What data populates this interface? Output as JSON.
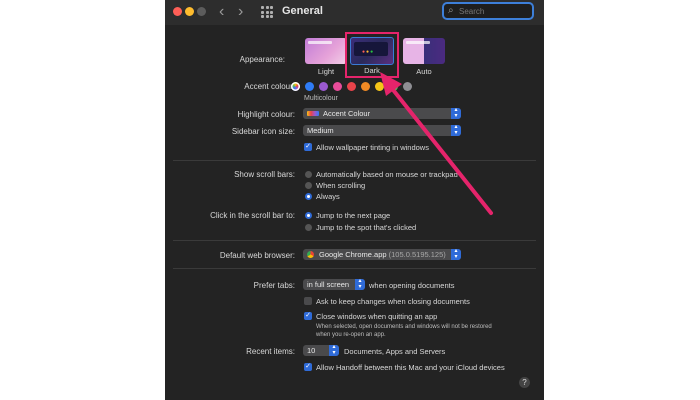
{
  "window": {
    "title": "General",
    "search_placeholder": "Search",
    "back_icon": "‹",
    "forward_icon": "›"
  },
  "appearance": {
    "label": "Appearance:",
    "options": [
      {
        "label": "Light"
      },
      {
        "label": "Dark"
      },
      {
        "label": "Auto"
      }
    ],
    "selected": "Dark"
  },
  "accent": {
    "label": "Accent colour:",
    "colors": [
      "multicolor",
      "#2f7cf6",
      "#9b59d0",
      "#e84c9a",
      "#e8434a",
      "#f08a24",
      "#f5c518",
      "#5cb85c",
      "#8e8e93"
    ],
    "selected_caption": "Multicolour"
  },
  "highlight": {
    "label": "Highlight colour:",
    "value": "Accent Colour"
  },
  "sidebar_icon_size": {
    "label": "Sidebar icon size:",
    "value": "Medium"
  },
  "wallpaper_tinting": {
    "label": "Allow wallpaper tinting in windows",
    "checked": true
  },
  "scroll_bars": {
    "label": "Show scroll bars:",
    "options": [
      "Automatically based on mouse or trackpad",
      "When scrolling",
      "Always"
    ],
    "selected": "Always"
  },
  "scroll_click": {
    "label": "Click in the scroll bar to:",
    "options": [
      "Jump to the next page",
      "Jump to the spot that's clicked"
    ],
    "selected": "Jump to the next page"
  },
  "browser": {
    "label": "Default web browser:",
    "value": "Google Chrome.app",
    "version": "(105.0.5195.125)"
  },
  "tabs": {
    "label": "Prefer tabs:",
    "value": "in full screen",
    "suffix": "when opening documents"
  },
  "ask_keep_changes": {
    "label": "Ask to keep changes when closing documents",
    "checked": false
  },
  "close_windows": {
    "label": "Close windows when quitting an app",
    "checked": true,
    "note_line1": "When selected, open documents and windows will not be restored",
    "note_line2": "when you re-open an app."
  },
  "recent_items": {
    "label": "Recent items:",
    "value": "10",
    "suffix": "Documents, Apps and Servers"
  },
  "handoff": {
    "label": "Allow Handoff between this Mac and your iCloud devices",
    "checked": true
  },
  "help_glyph": "?",
  "colors": {
    "annotation": "#e5246b",
    "accent": "#2f6bd8",
    "window_bg": "#232323"
  }
}
